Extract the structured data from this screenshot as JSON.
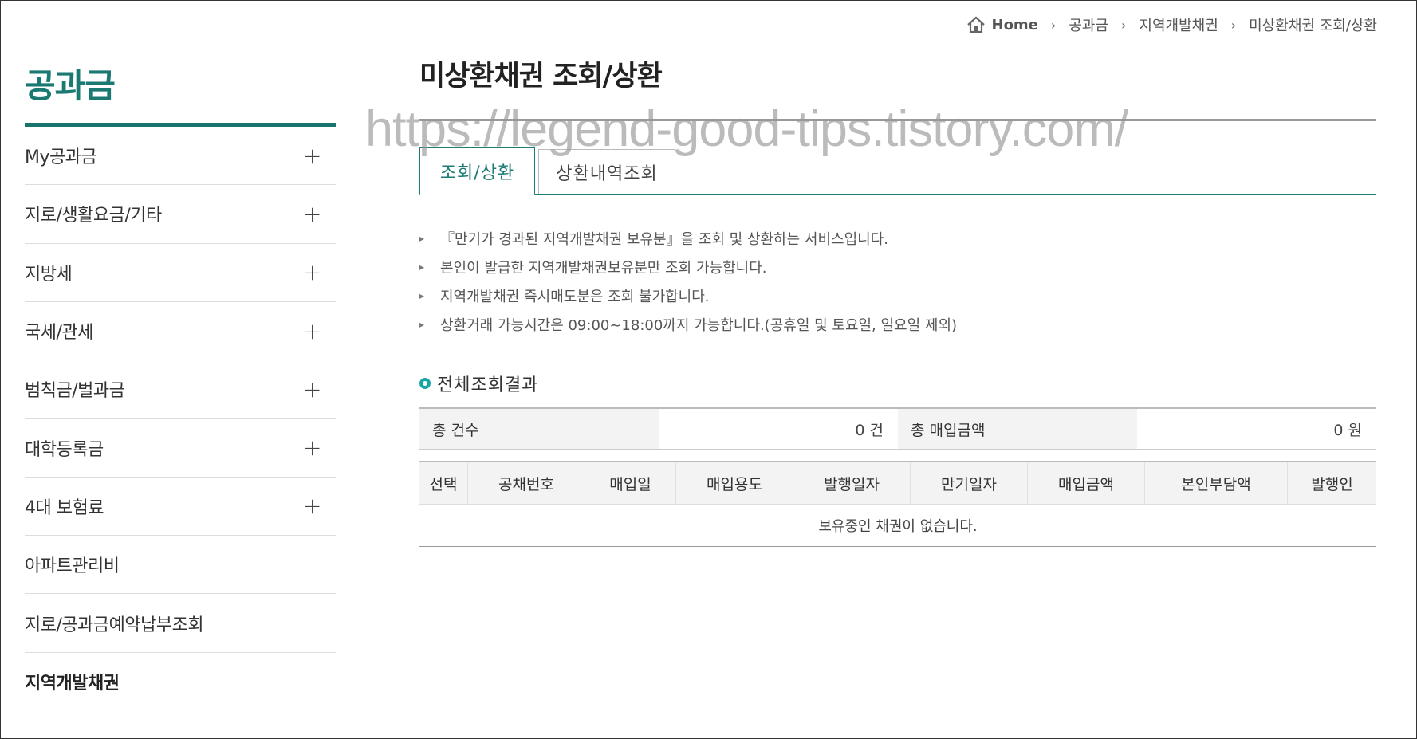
{
  "breadcrumb": {
    "home_icon": "home-icon",
    "items": [
      "Home",
      "공과금",
      "지역개발채권",
      "미상환채권 조회/상환"
    ]
  },
  "sidebar": {
    "title": "공과금",
    "accent": "#1a7a72",
    "items": [
      {
        "label": "My공과금",
        "expand": "+"
      },
      {
        "label": "지로/생활요금/기타",
        "expand": "+"
      },
      {
        "label": "지방세",
        "expand": "+"
      },
      {
        "label": "국세/관세",
        "expand": "+"
      },
      {
        "label": "범칙금/벌과금",
        "expand": "+"
      },
      {
        "label": "대학등록금",
        "expand": "+"
      },
      {
        "label": "4대 보험료",
        "expand": "+"
      },
      {
        "label": "아파트관리비"
      },
      {
        "label": "지로/공과금예약납부조회"
      },
      {
        "label": "지역개발채권"
      }
    ]
  },
  "main": {
    "title": "미상환채권 조회/상환",
    "watermark": "https://legend-good-tips.tistory.com/",
    "tabs": [
      {
        "label": "조회/상환",
        "active": true
      },
      {
        "label": "상환내역조회",
        "active": false
      }
    ],
    "notes": [
      "『만기가 경과된 지역개발채권 보유분』을 조회 및 상환하는 서비스입니다.",
      "본인이 발급한 지역개발채권보유분만 조회 가능합니다.",
      "지역개발채권 즉시매도분은 조회 불가합니다.",
      "상환거래 가능시간은 09:00~18:00까지 가능합니다.(공휴일 및 토요일, 일요일 제외)"
    ],
    "section_title": "전체조회결과",
    "summary": {
      "count_label": "총 건수",
      "count_value": "0 건",
      "amount_label": "총 매입금액",
      "amount_value": "0 원"
    },
    "table": {
      "headers": [
        "선택",
        "공채번호",
        "매입일",
        "매입용도",
        "발행일자",
        "만기일자",
        "매입금액",
        "본인부담액",
        "발행인"
      ],
      "empty_message": "보유중인 채권이 없습니다."
    }
  }
}
